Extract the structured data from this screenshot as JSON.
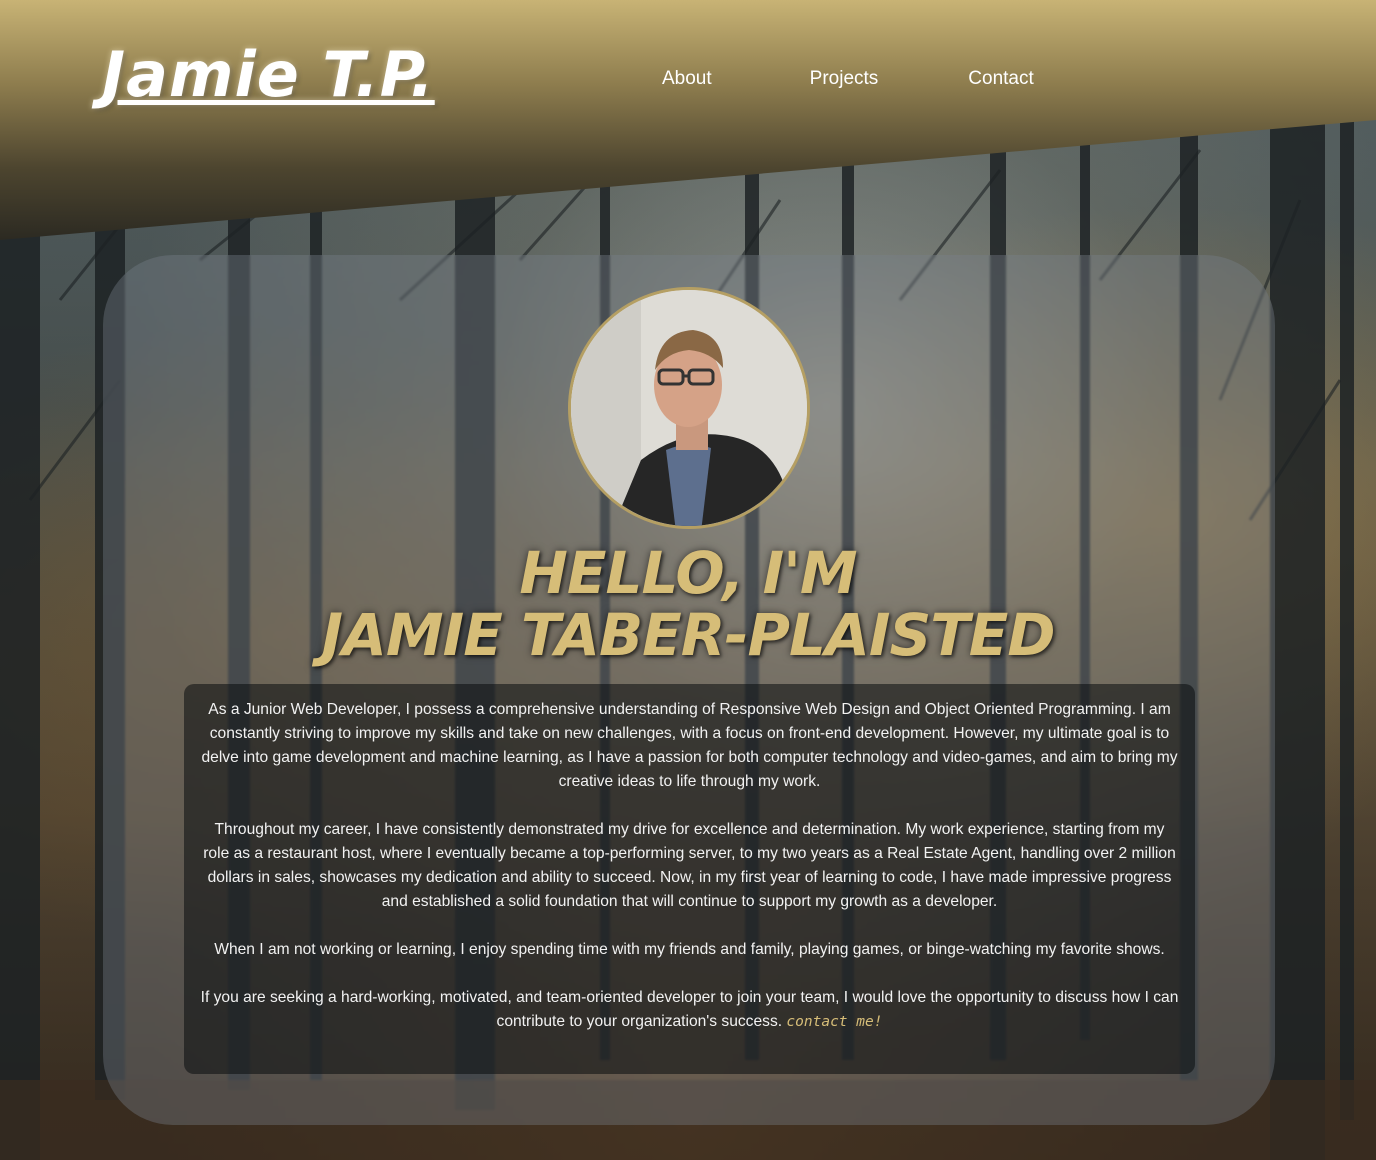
{
  "header": {
    "logo": "Jamie T.P.",
    "nav": [
      "About",
      "Projects",
      "Contact"
    ]
  },
  "hero": {
    "avatar_alt": "portrait",
    "headline_line1": "HELLO, I'M",
    "headline_line2": "JAMIE TABER-PLAISTED"
  },
  "bio": {
    "p1": "As a Junior Web Developer, I possess a comprehensive understanding of Responsive Web Design and Object Oriented Programming. I am constantly striving to improve my skills and take on new challenges, with a focus on front-end development. However, my ultimate goal is to delve into game development and machine learning, as I have a passion for both computer technology and video-games, and aim to bring my creative ideas to life through my work.",
    "p2": "Throughout my career, I have consistently demonstrated my drive for excellence and determination. My work experience, starting from my role as a restaurant host, where I eventually became a top-performing server, to my two years as a Real Estate Agent, handling over 2 million dollars in sales, showcases my dedication and ability to succeed. Now, in my first year of learning to code, I have made impressive progress and established a solid foundation that will continue to support my growth as a developer.",
    "p3": "When I am not working or learning, I enjoy spending time with my friends and family, playing games, or binge-watching my favorite shows.",
    "p4": "If you are seeking a hard-working, motivated, and team-oriented developer to join your team, I would love the opportunity to discuss how I can contribute to your organization's success.",
    "contact_link": "contact me!"
  },
  "colors": {
    "accent": "#d6bd78",
    "header_top": "#c8b375",
    "header_bottom": "#2c2a22"
  }
}
